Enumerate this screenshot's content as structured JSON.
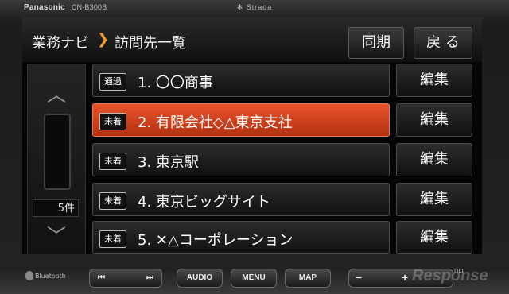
{
  "device": {
    "brand": "Panasonic",
    "model": "CN-B300B",
    "series": "✻ Strada"
  },
  "header": {
    "breadcrumb_root": "業務ナビ",
    "breadcrumb_current": "訪問先一覧",
    "sync_label": "同期",
    "back_label": "戻 る"
  },
  "sidebar": {
    "count_label": "5件"
  },
  "list": {
    "items": [
      {
        "badge": "通過",
        "title": "1. 〇〇商事",
        "edit": "編集"
      },
      {
        "badge": "未着",
        "title": "2. 有限会社◇△東京支社",
        "edit": "編集"
      },
      {
        "badge": "未着",
        "title": "3. 東京駅",
        "edit": "編集"
      },
      {
        "badge": "未着",
        "title": "4. 東京ビッグサイト",
        "edit": "編集"
      },
      {
        "badge": "未着",
        "title": "5. ✕△コーポレーション",
        "edit": "編集"
      }
    ]
  },
  "controls": {
    "bluetooth": "Bluetooth",
    "prev": "⏮",
    "next": "⏭",
    "audio": "AUDIO",
    "menu": "MENU",
    "map": "MAP",
    "vol_minus": "−",
    "vol_plus": "+",
    "tilt": "TILT"
  },
  "watermark": "Response"
}
